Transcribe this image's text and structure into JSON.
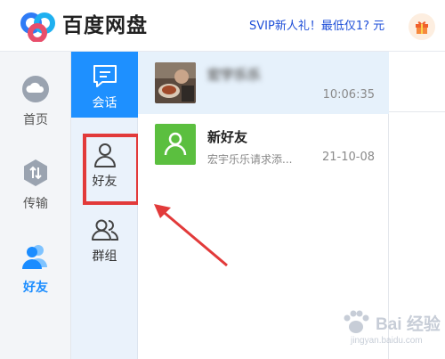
{
  "app": {
    "title": "百度网盘",
    "promo": "SVIP新人礼！最低仅1? 元",
    "accent": "#1e90ff"
  },
  "left_nav": [
    {
      "label": "首页",
      "icon": "cloud-icon"
    },
    {
      "label": "传输",
      "icon": "transfer-icon"
    },
    {
      "label": "好友",
      "icon": "friends-icon",
      "active": true
    }
  ],
  "sub_nav": [
    {
      "label": "会话",
      "icon": "chat-icon",
      "selected": true
    },
    {
      "label": "好友",
      "icon": "person-icon"
    },
    {
      "label": "群组",
      "icon": "group-icon"
    }
  ],
  "conversations": [
    {
      "name": "宏宇乐乐",
      "time": "10:06:35",
      "active": true
    },
    {
      "name": "新好友",
      "preview": "宏宇乐乐请求添...",
      "time": "21-10-08"
    }
  ],
  "watermark": {
    "brand": "Bai 经验",
    "url": "jingyan.baidu.com"
  }
}
